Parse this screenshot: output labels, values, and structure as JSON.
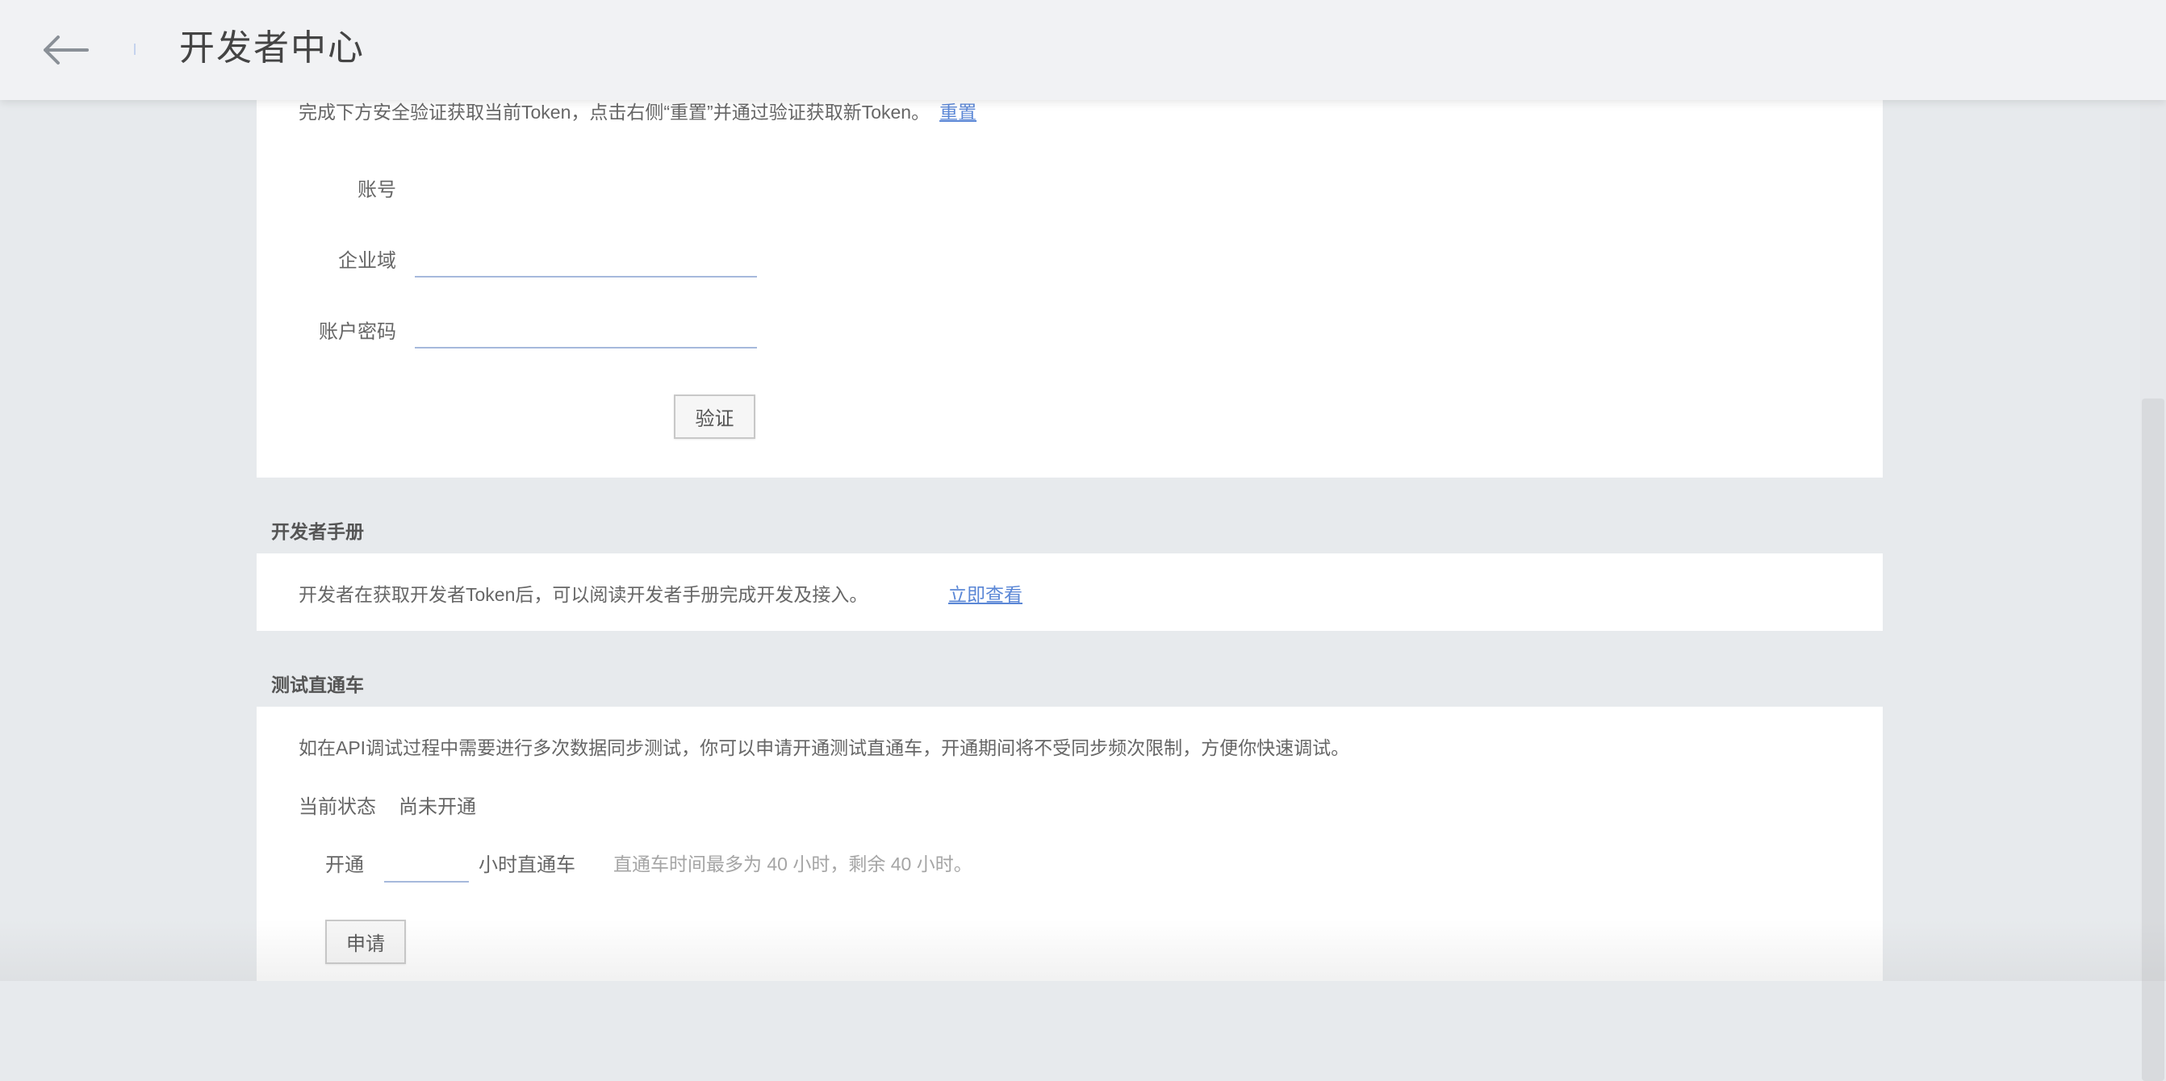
{
  "header": {
    "title": "开发者中心",
    "back_icon": "arrow-left-icon"
  },
  "token_section": {
    "instruction": "完成下方安全验证获取当前Token，点击右侧“重置”并通过验证获取新Token。",
    "reset_link": "重置",
    "account_label": "账号",
    "domain_label": "企业域",
    "password_label": "账户密码",
    "domain_value": "",
    "password_value": "",
    "verify_button": "验证"
  },
  "manual_section": {
    "title": "开发者手册",
    "description": "开发者在获取开发者Token后，可以阅读开发者手册完成开发及接入。",
    "view_link": "立即查看"
  },
  "test_section": {
    "title": "测试直通车",
    "description": "如在API调试过程中需要进行多次数据同步测试，你可以申请开通测试直通车，开通期间将不受同步频次限制，方便你快速调试。",
    "status_label": "当前状态",
    "status_value": "尚未开通",
    "open_label": "开通",
    "hours_value": "",
    "hours_suffix": "小时直通车",
    "hint": "直通车时间最多为 40 小时，剩余 40 小时。",
    "apply_button": "申请"
  },
  "colors": {
    "link": "#5b87d6",
    "input_underline": "#a6b9dc",
    "page_background": "#e7eaed",
    "header_background": "#f1f2f4"
  }
}
